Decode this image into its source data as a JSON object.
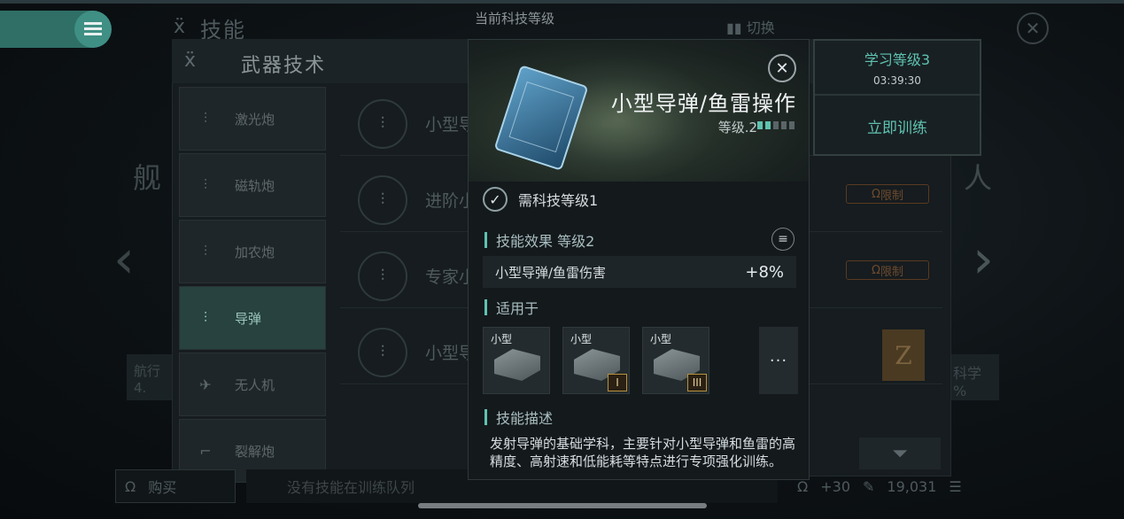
{
  "background": {
    "page_title": "技能",
    "tech_level_label": "当前科技等级",
    "switch_label": "切换",
    "left_char": "舰",
    "right_char": "人",
    "left_card": "航行",
    "left_card_value": "4.",
    "right_card": "科学",
    "right_card_value": "%"
  },
  "panel": {
    "title": "武器技术",
    "sidebar": [
      {
        "label": "激光炮"
      },
      {
        "label": "磁轨炮"
      },
      {
        "label": "加农炮"
      },
      {
        "label": "导弹"
      },
      {
        "label": "无人机"
      },
      {
        "label": "裂解炮"
      }
    ],
    "skills": [
      {
        "name": "小型导"
      },
      {
        "name": "进阶小"
      },
      {
        "name": "专家小"
      },
      {
        "name": "小型导"
      }
    ],
    "limit_label": "限制"
  },
  "bottom": {
    "buy_label": "购买",
    "queue_text": "没有技能在训练队列",
    "res1": "+30",
    "res2": "19,031"
  },
  "modal": {
    "title": "小型导弹/鱼雷操作",
    "level_text": "等级.2",
    "level_current": 2,
    "level_max": 5,
    "requirement": "需科技等级1",
    "effect_header": "技能效果 等级2",
    "effect_name": "小型导弹/鱼雷伤害",
    "effect_value": "+8%",
    "applies_header": "适用于",
    "launchers": [
      {
        "label": "小型",
        "tier": ""
      },
      {
        "label": "小型",
        "tier": "I"
      },
      {
        "label": "小型",
        "tier": "III"
      }
    ],
    "more_label": "···",
    "desc_header": "技能描述",
    "description": "发射导弹的基础学科，主要针对小型导弹和鱼雷的高精度、高射速和低能耗等特点进行专项强化训练。"
  },
  "train": {
    "title": "学习等级3",
    "timer": "03:39:30",
    "button": "立即训练"
  },
  "colors": {
    "accent": "#5fc2b0",
    "limit": "#6d4a2e"
  }
}
